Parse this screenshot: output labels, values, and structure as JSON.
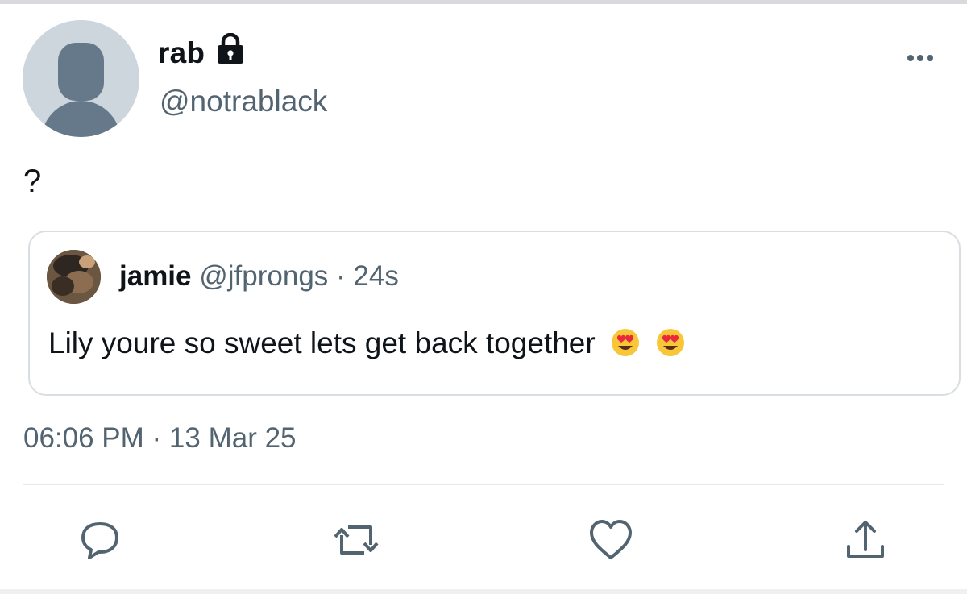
{
  "tweet": {
    "author": {
      "name": "rab",
      "handle": "@notrablack",
      "protected": true
    },
    "text": "?",
    "timestamp": "06:06 PM · 13 Mar 25",
    "quoted": {
      "author": {
        "name": "jamie",
        "handle": "@jfprongs"
      },
      "time_ago": "24s",
      "text": "Lily youre so sweet lets get back together",
      "emojis": [
        "smiling-face-with-heart-eyes",
        "smiling-face-with-heart-eyes"
      ]
    }
  },
  "actions": [
    "reply",
    "retweet",
    "like",
    "share"
  ],
  "colors": {
    "text_primary": "#0f1419",
    "text_secondary": "#536471",
    "border": "#d9dee2",
    "avatar_placeholder": "#cdd6dd",
    "icon": "#536471"
  }
}
